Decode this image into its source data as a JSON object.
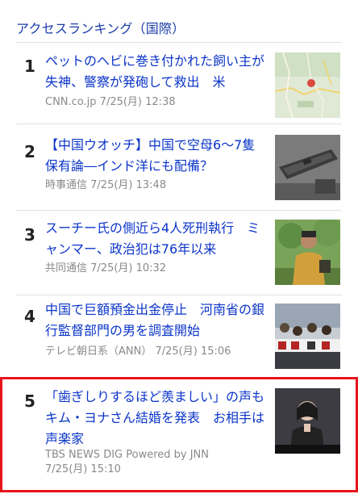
{
  "section_title": "アクセスランキング（国際）",
  "items": [
    {
      "rank": "1",
      "title": "ペットのヘビに巻き付かれた飼い主が失神、警察が発砲して救出　米",
      "source": "CNN.co.jp",
      "time": "7/25(月) 12:38",
      "thumb_icon": "map-thumbnail"
    },
    {
      "rank": "2",
      "title": "【中国ウオッチ】中国で空母6～7隻保有論―インド洋にも配備？",
      "source": "時事通信",
      "time": "7/25(月) 13:48",
      "thumb_icon": "aircraft-carrier-photo"
    },
    {
      "rank": "3",
      "title": "スーチー氏の側近ら4人死刑執行　ミャンマー、政治犯は76年以来",
      "source": "共同通信",
      "time": "7/25(月) 10:32",
      "thumb_icon": "person-photo"
    },
    {
      "rank": "4",
      "title": "中国で巨額預金出金停止　河南省の銀行監督部門の男を調査開始",
      "source": "テレビ朝日系（ANN）",
      "time": "7/25(月) 15:06",
      "thumb_icon": "protest-photo"
    },
    {
      "rank": "5",
      "title": "「歯ぎしりするほど羨ましい」の声も　キム・ヨナさん結婚を発表　お相手は声楽家",
      "source": "TBS NEWS DIG Powered by JNN",
      "time": "7/25(月) 15:10",
      "thumb_icon": "anchor-photo"
    }
  ]
}
